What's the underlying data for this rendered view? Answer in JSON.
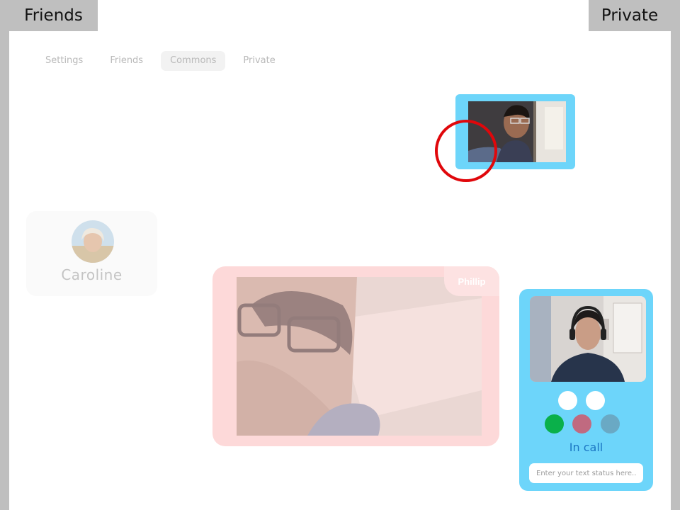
{
  "corner_tabs": {
    "left": "Friends",
    "right": "Private"
  },
  "nav": {
    "items": [
      {
        "label": "Settings",
        "active": false
      },
      {
        "label": "Friends",
        "active": false
      },
      {
        "label": "Commons",
        "active": true
      },
      {
        "label": "Private",
        "active": false
      }
    ]
  },
  "contact": {
    "name": "Caroline"
  },
  "call": {
    "participant_name": "Phillip"
  },
  "user_card": {
    "status": "In call",
    "status_placeholder": "Enter your text status here..",
    "buttons": [
      {
        "name": "white-toggle-1",
        "color": "#ffffff"
      },
      {
        "name": "white-toggle-2",
        "color": "#ffffff"
      },
      {
        "name": "green-status",
        "color": "#0ab04a"
      },
      {
        "name": "rose-status",
        "color": "#c06a80"
      },
      {
        "name": "blue-status",
        "color": "#6aa9c4"
      }
    ]
  },
  "colors": {
    "accent_blue": "#6dd5fa",
    "call_tile_pink": "#fdd9d9",
    "marker_red": "#e0070b",
    "status_text": "#1b76c3"
  }
}
